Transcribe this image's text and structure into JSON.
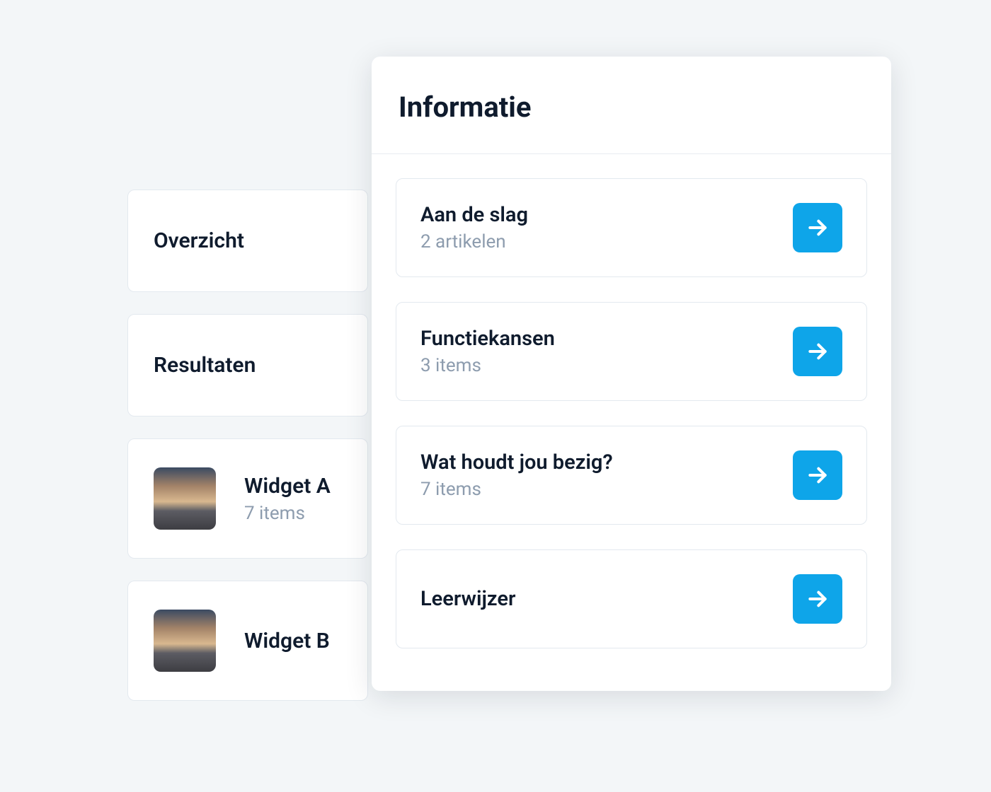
{
  "back": {
    "items": [
      {
        "title": "Overzicht"
      },
      {
        "title": "Resultaten"
      },
      {
        "title": "Widget A",
        "sub": "7 items",
        "thumb": true
      },
      {
        "title": "Widget B",
        "thumb": true
      }
    ]
  },
  "panel": {
    "title": "Informatie",
    "items": [
      {
        "title": "Aan de slag",
        "sub": "2 artikelen"
      },
      {
        "title": "Functiekansen",
        "sub": "3 items"
      },
      {
        "title": "Wat houdt jou bezig?",
        "sub": "7 items"
      },
      {
        "title": "Leerwijzer"
      }
    ]
  },
  "icons": {
    "arrow_right": "arrow-right-icon"
  },
  "colors": {
    "accent": "#0ea5e9",
    "text_primary": "#0f1b2d",
    "text_secondary": "#8d9cae",
    "border": "#e3e9ef",
    "background": "#f3f6f8"
  }
}
